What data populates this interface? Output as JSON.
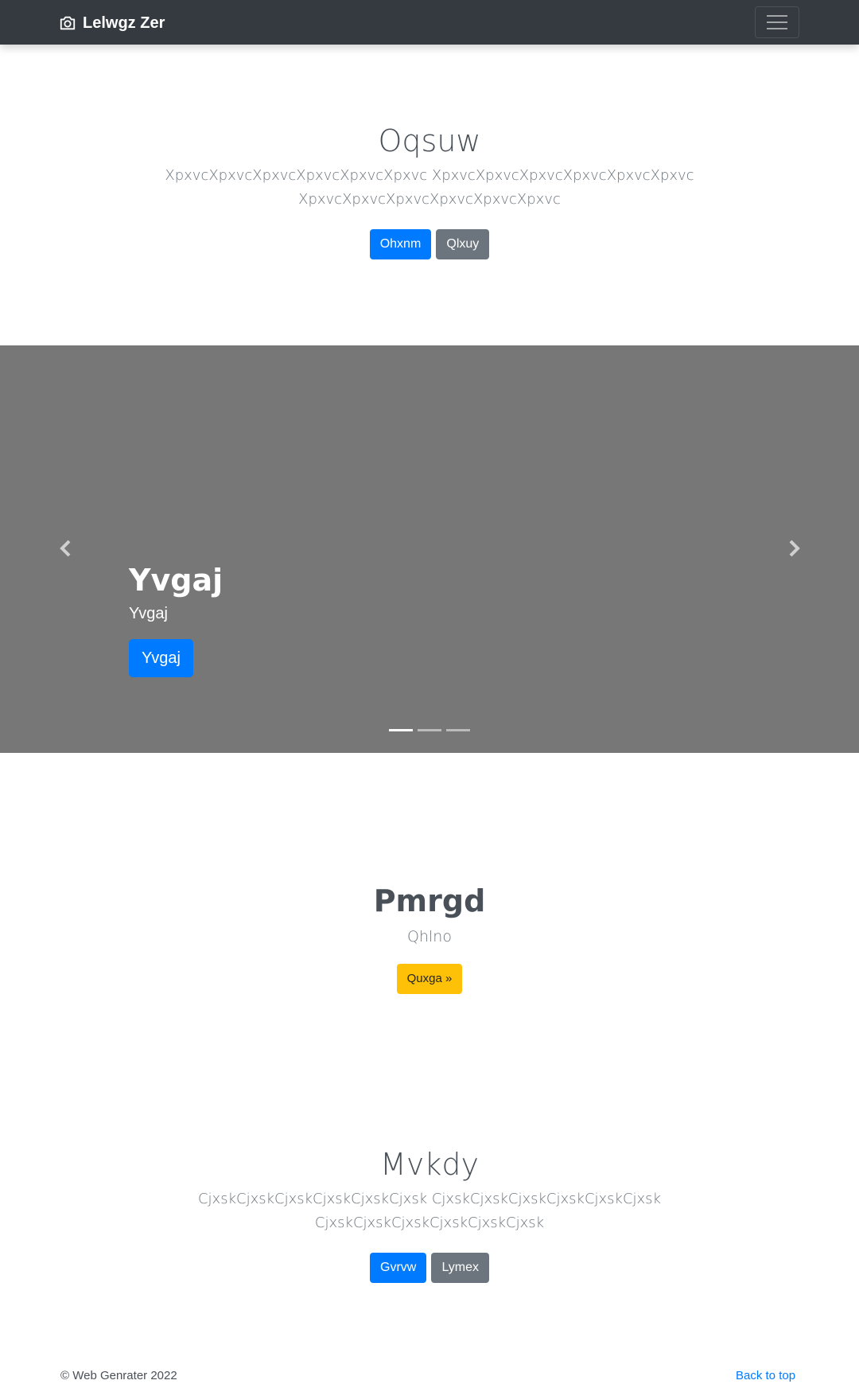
{
  "navbar": {
    "brand": "Lelwgz Zer",
    "brand_icon": "camera-icon",
    "toggle_icon": "hamburger-menu-icon"
  },
  "hero": {
    "title": "Oqsuw",
    "lead_line1": "XpxvcXpxvcXpxvcXpxvcXpxvcXpxvc XpxvcXpxvcXpxvcXpxvcXpxvcXpxvc",
    "lead_line2": "XpxvcXpxvcXpxvcXpxvcXpxvcXpxvc",
    "primary_button": "Ohxnm",
    "secondary_button": "Qlxuy"
  },
  "carousel": {
    "slide_title": "Yvgaj",
    "slide_text": "Yvgaj",
    "slide_button": "Yvgaj",
    "prev_icon": "chevron-left-icon",
    "next_icon": "chevron-right-icon",
    "indicator_count": 3,
    "active_index": 0,
    "background_color": "#777777"
  },
  "feature": {
    "title": "Pmrgd",
    "subtitle": "Qhlno",
    "button": "Quxga »"
  },
  "section2": {
    "title": "Mvkdy",
    "lead_line1": "CjxskCjxskCjxskCjxskCjxskCjxsk CjxskCjxskCjxskCjxskCjxskCjxsk",
    "lead_line2": "CjxskCjxskCjxskCjxskCjxskCjxsk",
    "primary_button": "Gvrvw",
    "secondary_button": "Lymex"
  },
  "footer": {
    "copyright": "© Web Genrater 2022",
    "back_to_top": "Back to top"
  }
}
